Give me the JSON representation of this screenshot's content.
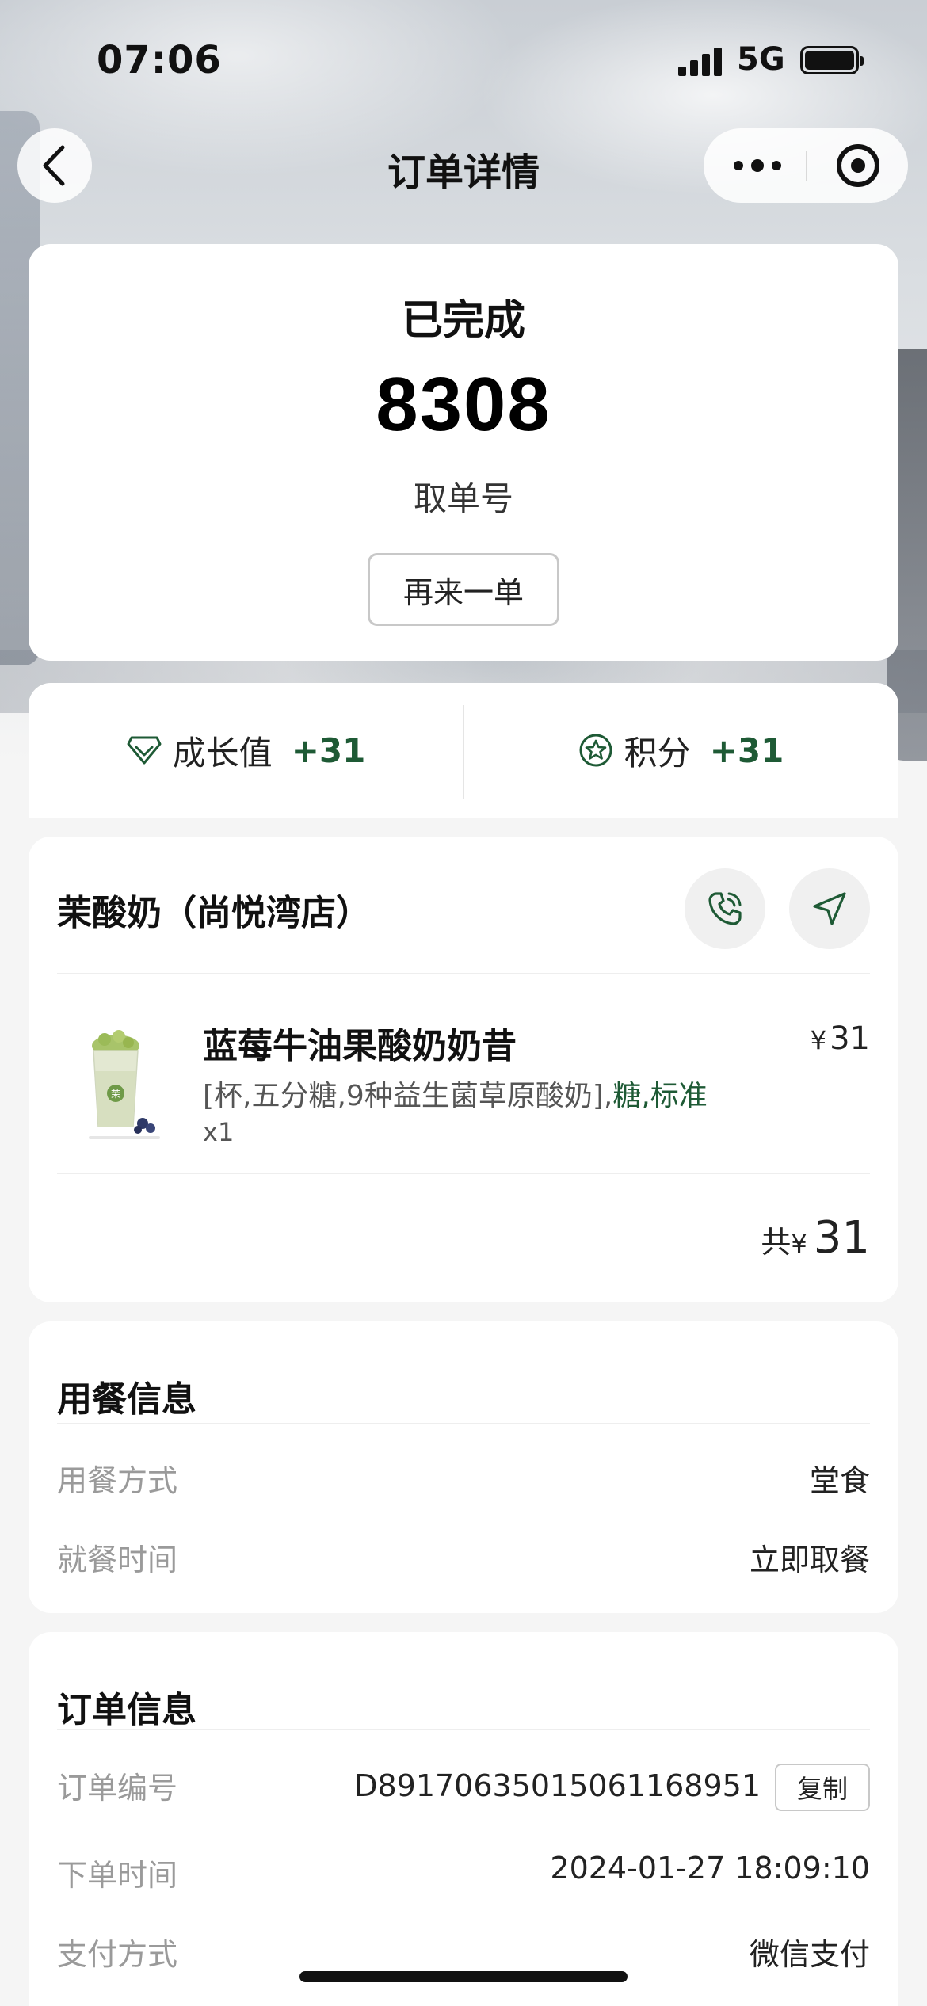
{
  "status_bar": {
    "time": "07:06",
    "network": "5G"
  },
  "nav": {
    "title": "订单详情"
  },
  "order_status": {
    "status": "已完成",
    "pickup_number": "8308",
    "pickup_label": "取单号",
    "reorder_label": "再来一单"
  },
  "rewards": {
    "growth_label": "成长值",
    "growth_value": "+31",
    "points_label": "积分",
    "points_value": "+31"
  },
  "store": {
    "name": "茉酸奶（尚悦湾店）",
    "items": [
      {
        "name": "蓝莓牛油果酸奶奶昔",
        "price_symbol": "¥",
        "price": "31",
        "spec_main": "[杯,五分糖,9种益生菌草原酸奶],",
        "spec_highlight": "糖,标准",
        "qty": "x1"
      }
    ],
    "total_prefix": "共",
    "total_symbol": "¥",
    "total_amount": "31"
  },
  "dine_info": {
    "title": "用餐信息",
    "rows": [
      {
        "label": "用餐方式",
        "value": "堂食"
      },
      {
        "label": "就餐时间",
        "value": "立即取餐"
      }
    ]
  },
  "order_info": {
    "title": "订单信息",
    "order_no_label": "订单编号",
    "order_no": "D89170635015061168951",
    "copy_label": "复制",
    "time_label": "下单时间",
    "time_value": "2024-01-27 18:09:10",
    "pay_label": "支付方式",
    "pay_value": "微信支付"
  },
  "colors": {
    "accent_green": "#1e5a35",
    "card_bg": "#ffffff",
    "page_bg": "#f5f5f5"
  },
  "icons": [
    "back-chevron-icon",
    "more-dots-icon",
    "target-icon",
    "diamond-icon",
    "star-badge-icon",
    "phone-icon",
    "navigation-arrow-icon"
  ]
}
